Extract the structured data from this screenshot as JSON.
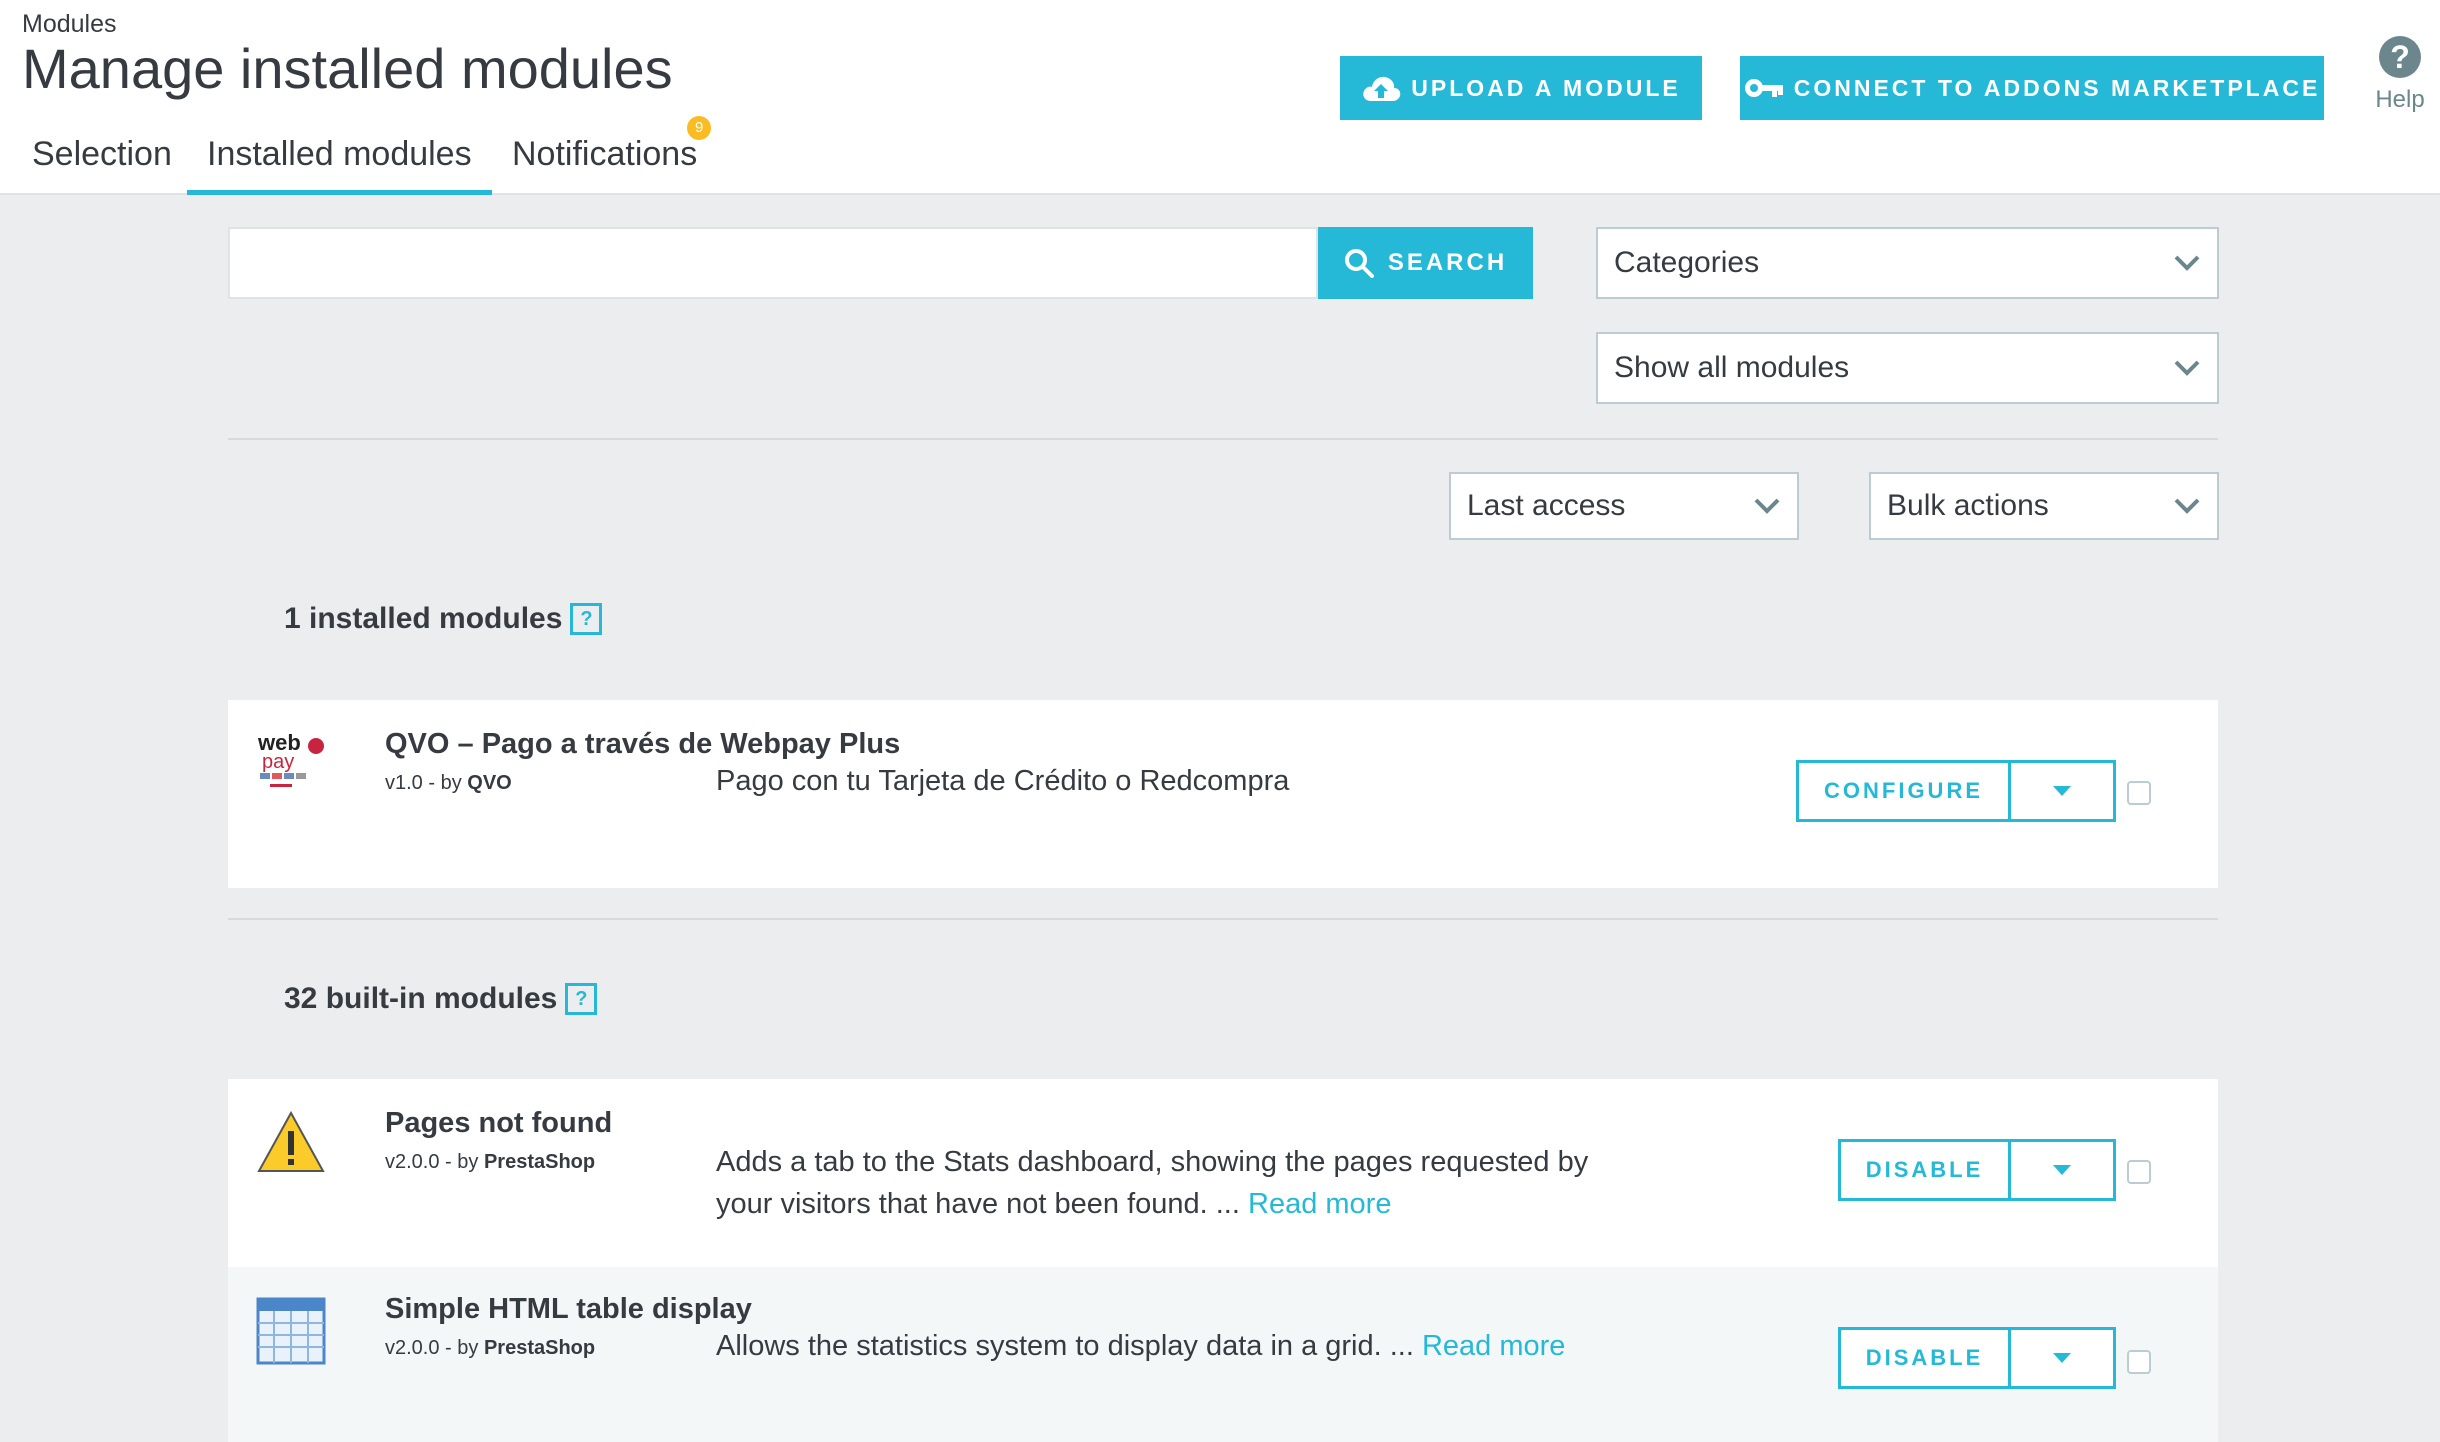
{
  "header": {
    "breadcrumb": "Modules",
    "title": "Manage installed modules",
    "tabs": [
      {
        "label": "Selection"
      },
      {
        "label": "Installed modules"
      },
      {
        "label": "Notifications",
        "badge": "9"
      }
    ],
    "upload_button": "UPLOAD A MODULE",
    "addons_button": "CONNECT TO ADDONS MARKETPLACE",
    "help_label": "Help",
    "help_icon": "question-circle-icon"
  },
  "filters": {
    "search_value": "",
    "search_button": "SEARCH",
    "categories_select": "Categories",
    "status_select": "Show all modules",
    "sort_select": "Last access",
    "bulk_select": "Bulk actions"
  },
  "installed_section": {
    "title": "1 installed modules",
    "modules": [
      {
        "name": "QVO – Pago a través de Webpay Plus",
        "version": "v1.0 - by",
        "author": "QVO",
        "description": "Pago con tu Tarjeta de Crédito o Redcompra",
        "action": "CONFIGURE",
        "logo_text": "web pay plus"
      }
    ]
  },
  "builtin_section": {
    "title": "32 built-in modules",
    "modules": [
      {
        "name": "Pages not found",
        "version": "v2.0.0 - by",
        "author": "PrestaShop",
        "description": "Adds a tab to the Stats dashboard, showing the pages requested by your visitors that have not been found. ...",
        "read_more": "Read more",
        "action": "DISABLE"
      },
      {
        "name": "Simple HTML table display",
        "version": "v2.0.0 - by",
        "author": "PrestaShop",
        "description": "Allows the statistics system to display data in a grid. ...",
        "read_more": "Read more",
        "action": "DISABLE"
      }
    ]
  },
  "colors": {
    "accent": "#25b9d7",
    "badge": "#fbbb22",
    "background": "#ebedef",
    "text": "#363a41"
  }
}
